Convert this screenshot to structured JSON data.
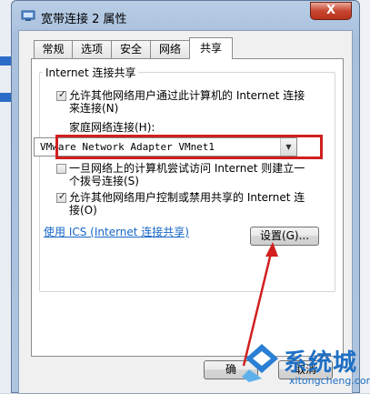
{
  "window": {
    "title": "宽带连接 2 属性",
    "close_label": "X"
  },
  "tabs": [
    {
      "label": "常规"
    },
    {
      "label": "选项"
    },
    {
      "label": "安全"
    },
    {
      "label": "网络"
    },
    {
      "label": "共享"
    }
  ],
  "active_tab": "共享",
  "sharing": {
    "group_title": "Internet 连接共享",
    "allow_share": {
      "label_line1": "允许其他网络用户通过此计算机的 Internet 连接",
      "label_line2": "来连接(N)",
      "checked": true
    },
    "home_network_label": "家庭网络连接(H):",
    "home_network_value": "VMware Network Adapter VMnet1",
    "dial_on_demand": {
      "label_line1": "一旦网络上的计算机尝试访问 Internet 则建立一",
      "label_line2": "个拨号连接(S)",
      "checked": false
    },
    "allow_control": {
      "label_line1": "允许其他网络用户控制或禁用共享的 Internet 连",
      "label_line2": "接(O)",
      "checked": true
    },
    "ics_link": "使用 ICS (Internet 连接共享)",
    "settings_button": "设置(G)..."
  },
  "footer": {
    "ok_label": "确",
    "cancel_label": "取消"
  },
  "watermark": {
    "text": "系统城",
    "url": "xitongcheng.com"
  },
  "colors": {
    "highlight_box": "#d11f1f",
    "link": "#1666c5"
  }
}
